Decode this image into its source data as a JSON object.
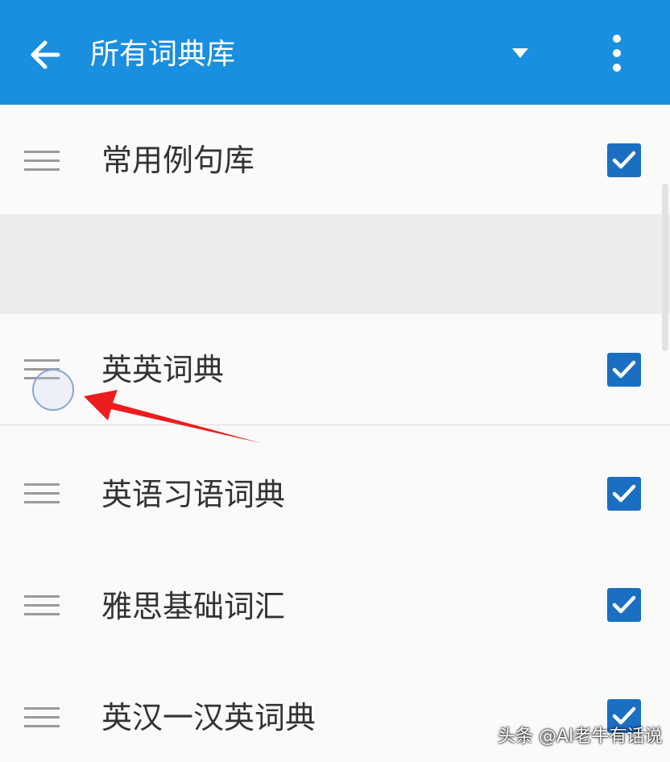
{
  "header": {
    "title": "所有词典库",
    "back_icon": "arrow-left-icon",
    "dropdown_icon": "caret-down-icon",
    "more_icon": "more-vertical-icon",
    "background_color": "#1a8fe0"
  },
  "dictionaries": [
    {
      "label": "常用例句库",
      "checked": true
    },
    {
      "label": "英英词典",
      "checked": true
    },
    {
      "label": "英语习语词典",
      "checked": true
    },
    {
      "label": "雅思基础词汇",
      "checked": true
    },
    {
      "label": "英汉一汉英词典",
      "checked": true
    }
  ],
  "checkbox_color": "#1a6fc2",
  "annotation_arrow_color": "#ee1c1c",
  "watermark": "头条 @AI老牛有话说"
}
